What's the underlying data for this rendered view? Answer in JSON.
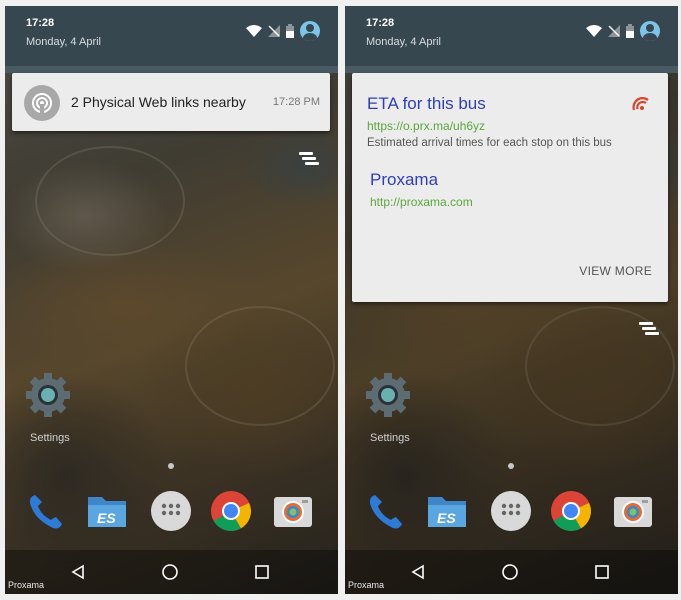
{
  "left_screen": {
    "status": {
      "time": "17:28",
      "date": "Monday, 4 April"
    },
    "notification": {
      "icon": "physical-web-icon",
      "title": "2 Physical Web links nearby",
      "time": "17:28 PM"
    },
    "home": {
      "settings_label": "Settings"
    },
    "brand": "Proxama"
  },
  "right_screen": {
    "status": {
      "time": "17:28",
      "date": "Monday, 4 April"
    },
    "card": {
      "links": [
        {
          "title": "ETA for this bus",
          "url": "https://o.prx.ma/uh6yz",
          "description": "Estimated arrival times for each stop on this bus"
        },
        {
          "title": "Proxama",
          "url": "http://proxama.com"
        }
      ],
      "view_more": "VIEW MORE"
    },
    "home": {
      "settings_label": "Settings"
    },
    "brand": "Proxama"
  },
  "colors": {
    "shade": "#37474f",
    "link_title": "#2f3fb8",
    "link_url": "#5aa83c",
    "logo_red": "#d9442a"
  }
}
